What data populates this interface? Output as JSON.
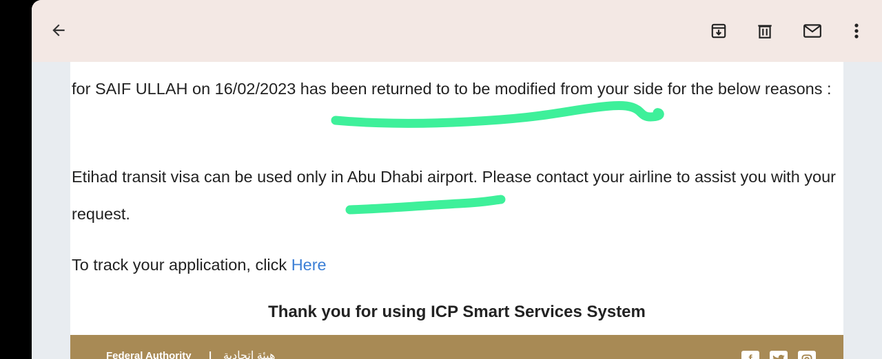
{
  "toolbar": {
    "back_icon": "arrow-left-icon",
    "archive_icon": "archive-icon",
    "delete_icon": "trash-icon",
    "mark_unread_icon": "envelope-icon",
    "more_icon": "more-vertical-icon"
  },
  "email": {
    "paragraph1": "for SAIF ULLAH on 16/02/2023 has been returned to to be modified from your side for the below reasons :",
    "paragraph2": "Etihad transit visa can be used only in Abu Dhabi airport. Please contact your airline to assist you with your request.",
    "track_text": "To track your application, click ",
    "track_link": "Here",
    "thanks": "Thank you for using ICP Smart Services System",
    "footer_authority": "Federal Authority",
    "footer_arabic": "هيئة اتحادية",
    "social": [
      "f",
      "t",
      "ig"
    ]
  },
  "colors": {
    "appbar": "#f3e8e4",
    "link": "#3b7fd6",
    "footer": "#a88a55",
    "highlight": "#3ef09a"
  }
}
